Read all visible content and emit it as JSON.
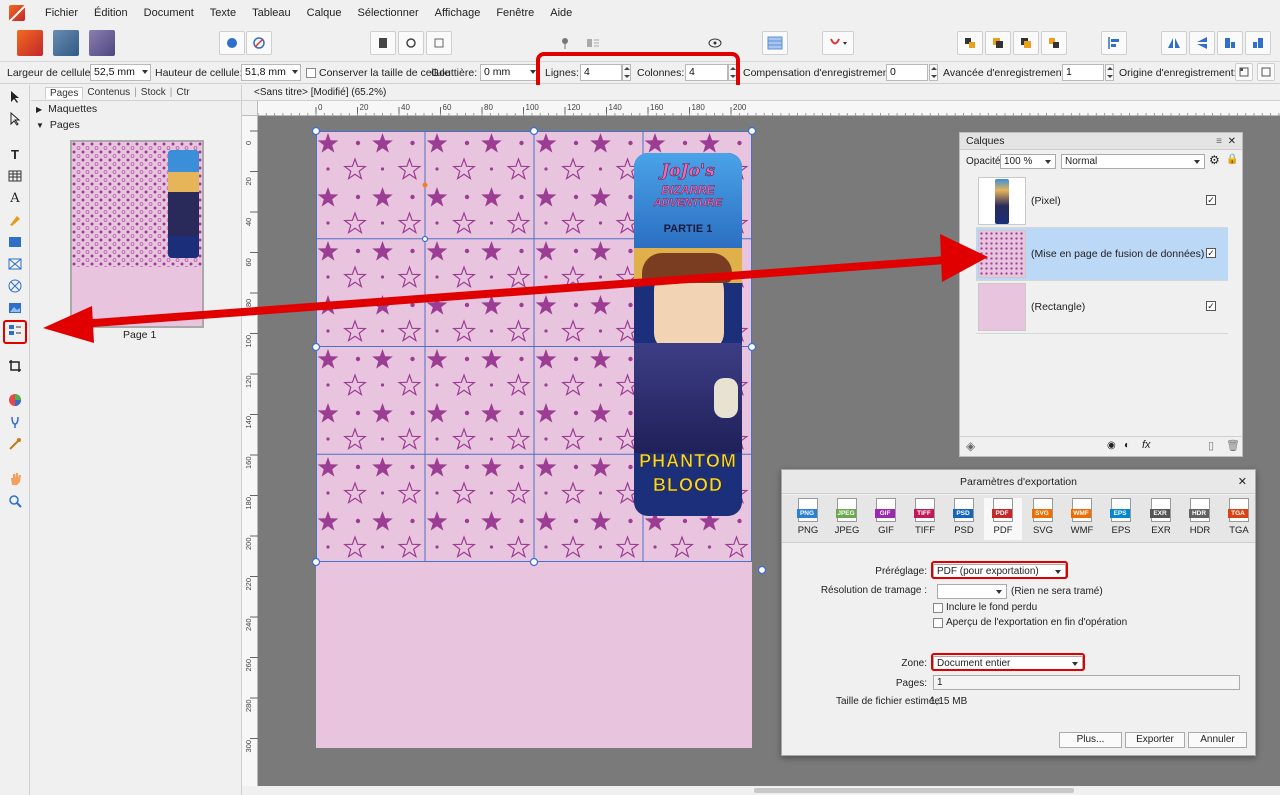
{
  "menu": {
    "items": [
      "Fichier",
      "Édition",
      "Document",
      "Texte",
      "Tableau",
      "Calque",
      "Sélectionner",
      "Affichage",
      "Fenêtre",
      "Aide"
    ]
  },
  "context_bar": {
    "cell_width_label": "Largeur de cellule:",
    "cell_width_value": "52,5 mm",
    "cell_height_label": "Hauteur de cellule:",
    "cell_height_value": "51,8 mm",
    "keep_size_label": "Conserver la taille de cellule",
    "gutter_label": "Gouttière:",
    "gutter_value": "0 mm",
    "rows_label": "Lignes:",
    "rows_value": "4",
    "columns_label": "Colonnes:",
    "columns_value": "4",
    "reg_comp_label": "Compensation d'enregistrement:",
    "reg_comp_value": "0",
    "reg_advance_label": "Avancée d'enregistrement:",
    "reg_advance_value": "1",
    "reg_origin_label": "Origine d'enregistrement:"
  },
  "pages_panel": {
    "tabs": [
      "Pages",
      "Contenus",
      "Stock",
      "Ctr"
    ],
    "sections": [
      "Maquettes",
      "Pages"
    ],
    "page_label": "Page 1"
  },
  "document": {
    "tab_title": "<Sans titre> [Modifié] (65.2%)"
  },
  "rulers": {
    "h_ticks": [
      "0",
      "20",
      "40",
      "60",
      "80",
      "100",
      "120",
      "140",
      "160",
      "180",
      "200"
    ],
    "v_ticks": [
      "0",
      "20",
      "40",
      "60",
      "80",
      "100",
      "120",
      "140",
      "160",
      "180",
      "200",
      "220",
      "240",
      "260",
      "280",
      "300"
    ]
  },
  "artwork": {
    "title_line1": "JoJo's",
    "title_line2": "BIZARRE",
    "title_line3": "ADVENTURE",
    "part": "PARTIE 1",
    "subtitle1": "PHANTOM",
    "subtitle2": "BLOOD"
  },
  "layers_panel": {
    "title": "Calques",
    "opacity_label": "Opacité:",
    "opacity_value": "100 %",
    "blend_mode": "Normal",
    "layers": [
      {
        "name": "(Pixel)",
        "checked": true
      },
      {
        "name": "(Mise en page de fusion de données)",
        "checked": true
      },
      {
        "name": "(Rectangle)",
        "checked": true
      }
    ]
  },
  "export_dialog": {
    "title": "Paramètres d'exportation",
    "formats": [
      "PNG",
      "JPEG",
      "GIF",
      "TIFF",
      "PSD",
      "PDF",
      "SVG",
      "WMF",
      "EPS",
      "EXR",
      "HDR",
      "TGA"
    ],
    "format_colors": [
      "#2b7fd6",
      "#6aa84f",
      "#9c27b0",
      "#c2185b",
      "#1565c0",
      "#c62828",
      "#ef6c00",
      "#ef6c00",
      "#0288d1",
      "#555555",
      "#616161",
      "#d84315"
    ],
    "active_format": "PDF",
    "preset_label": "Préréglage:",
    "preset_value": "PDF (pour exportation)",
    "raster_label": "Résolution de tramage :",
    "raster_note": "(Rien ne sera tramé)",
    "bleed_label": "Inclure le fond perdu",
    "preview_label": "Aperçu de l'exportation en fin d'opération",
    "zone_label": "Zone:",
    "zone_value": "Document entier",
    "pages_label": "Pages:",
    "pages_value": "1",
    "filesize_label": "Taille de fichier estimée:",
    "filesize_value": "1,15 MB",
    "more_button": "Plus...",
    "export_button": "Exporter",
    "cancel_button": "Annuler"
  },
  "colors": {
    "page_pink": "#e8c4df",
    "star_purple": "#9c3d94",
    "grid_blue": "#4a72c8",
    "highlight_red": "#e00000",
    "selection_blue": "#bcd8f7"
  }
}
